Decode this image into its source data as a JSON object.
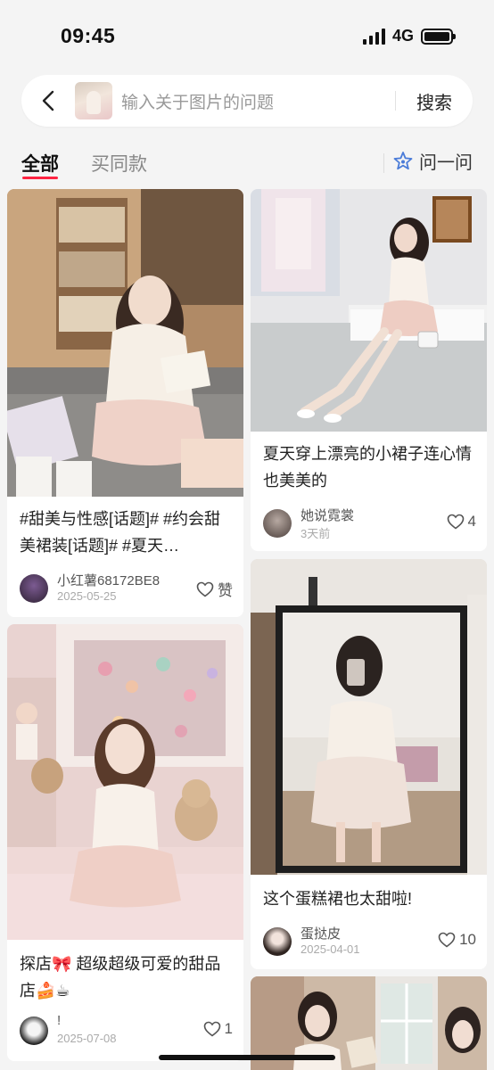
{
  "status": {
    "time": "09:45",
    "network": "4G",
    "battery_level": 1.0
  },
  "search": {
    "placeholder": "输入关于图片的问题",
    "button_label": "搜索"
  },
  "tabs": [
    {
      "label": "全部",
      "active": true
    },
    {
      "label": "买同款",
      "active": false
    }
  ],
  "ask": {
    "label": "问一问",
    "icon": "sparkle-star-icon"
  },
  "colors": {
    "accent": "#ff2442",
    "background": "#f4f4f4"
  },
  "cards": [
    {
      "title": "#甜美与性感[话题]# #约会甜美裙装[话题]# #夏天…",
      "author": "小红薯68172BE8",
      "date": "2025-05-25",
      "likes": "赞"
    },
    {
      "title": "夏天穿上漂亮的小裙子连心情也美美的",
      "author": "她说霓裳",
      "date": "3天前",
      "likes": "4"
    },
    {
      "title": "探店🎀 超级超级可爱的甜品店🍰☕",
      "author": "!",
      "date": "2025-07-08",
      "likes": "1"
    },
    {
      "title": "这个蛋糕裙也太甜啦!",
      "author": "蛋挞皮",
      "date": "2025-04-01",
      "likes": "10"
    },
    {
      "title": "",
      "author": "",
      "date": "",
      "likes": ""
    }
  ]
}
